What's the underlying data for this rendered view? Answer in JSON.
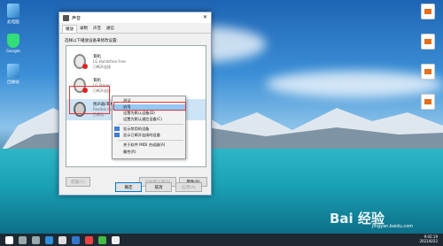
{
  "dialog": {
    "title": "声音",
    "close": "✕",
    "tabs": [
      "播放",
      "录制",
      "声音",
      "通信"
    ],
    "hint": "选择以下播放设备来修改设置:",
    "devices": [
      {
        "line1": "耳机",
        "line2": "LG Handsfree Free",
        "line3": "已断开连接"
      },
      {
        "line1": "耳机",
        "line2": "LG Stereo",
        "line3": "已断开连接"
      },
      {
        "line1": "扬声器/耳机",
        "line2": "Realtek High Definition",
        "line3": "已停用"
      }
    ],
    "buttons": {
      "configure": "配置(C)",
      "set_default": "设为默认值(S)",
      "properties": "属性(P)",
      "ok": "确定",
      "cancel": "取消",
      "apply": "应用(A)"
    }
  },
  "context_menu": {
    "items": [
      "测试",
      "启用",
      "设置为默认设备(D)",
      "设置为默认通信设备(C)",
      "显示禁用的设备",
      "显示已断开连接的设备",
      "关于软件 MIDI 合成器(A)",
      "属性(R)"
    ]
  },
  "desktop": {
    "left_icons": [
      "此电脑",
      "Google",
      "回收站"
    ],
    "right_icons": [
      "",
      "",
      "",
      ""
    ]
  },
  "taskbar": {
    "time": "9:02:19",
    "date": "2021/6/22"
  },
  "watermark": {
    "text": "Bai 经验",
    "sub": "jingyan.baidu.com"
  }
}
